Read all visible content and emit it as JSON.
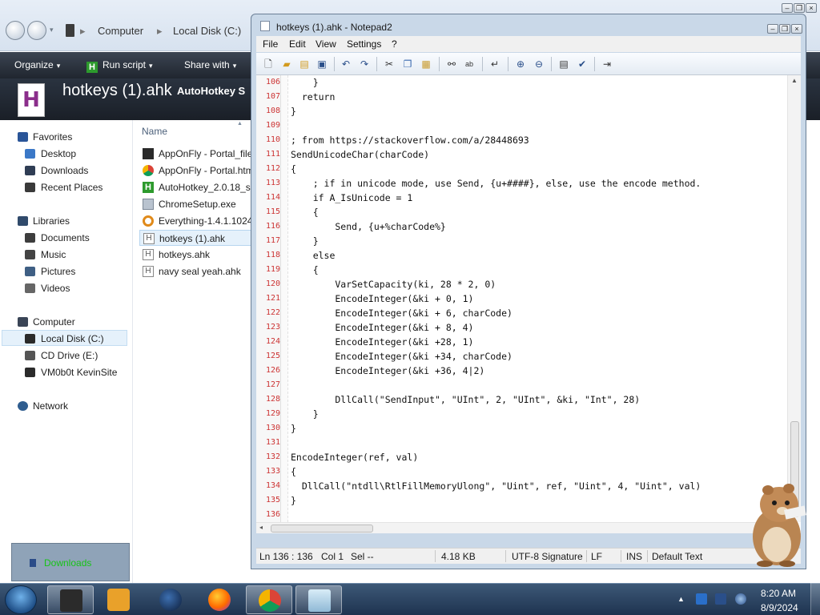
{
  "explorer": {
    "breadcrumb": {
      "sep": "▸",
      "computer": "Computer",
      "disk": "Local Disk (C:)"
    },
    "toolbar": {
      "organize": "Organize",
      "run_script": "Run script",
      "share_with": "Share with",
      "arrow": "▾"
    },
    "details": {
      "filename": "hotkeys (1).ahk",
      "type": "AutoHotkey S",
      "icon_letter": "H"
    },
    "nav": {
      "favorites": "Favorites",
      "desktop": "Desktop",
      "downloads": "Downloads",
      "recent": "Recent Places",
      "libraries": "Libraries",
      "documents": "Documents",
      "music": "Music",
      "pictures": "Pictures",
      "videos": "Videos",
      "computer": "Computer",
      "local_disk": "Local Disk (C:)",
      "cd_drive": "CD Drive (E:)",
      "vmshare": "VM0b0t KevinSite",
      "network": "Network"
    },
    "list": {
      "column_name": "Name",
      "files": [
        {
          "name": "AppOnFly - Portal_file",
          "icon": "app-icon"
        },
        {
          "name": "AppOnFly - Portal.htm",
          "icon": "chrome-icon"
        },
        {
          "name": "AutoHotkey_2.0.18_se",
          "icon": "autohotkey-icon"
        },
        {
          "name": "ChromeSetup.exe",
          "icon": "setup-icon"
        },
        {
          "name": "Everything-1.4.1.1024.",
          "icon": "everything-icon"
        },
        {
          "name": "hotkeys (1).ahk",
          "icon": "ahk-file-icon"
        },
        {
          "name": "hotkeys.ahk",
          "icon": "ahk-file-icon"
        },
        {
          "name": "navy seal yeah.ahk",
          "icon": "ahk-file-icon"
        }
      ]
    },
    "downloads_notification": "Downloads"
  },
  "notepad": {
    "title": "hotkeys (1).ahk - Notepad2",
    "menu": [
      "File",
      "Edit",
      "View",
      "Settings",
      "?"
    ],
    "lines": [
      {
        "n": "106",
        "text": "    }"
      },
      {
        "n": "107",
        "text": "  return"
      },
      {
        "n": "108",
        "text": "}"
      },
      {
        "n": "109",
        "text": ""
      },
      {
        "n": "110",
        "text": "; from https://stackoverflow.com/a/28448693"
      },
      {
        "n": "111",
        "text": "SendUnicodeChar(charCode)"
      },
      {
        "n": "112",
        "text": "{"
      },
      {
        "n": "113",
        "text": "    ; if in unicode mode, use Send, {u+####}, else, use the encode method."
      },
      {
        "n": "114",
        "text": "    if A_IsUnicode = 1"
      },
      {
        "n": "115",
        "text": "    {"
      },
      {
        "n": "116",
        "text": "        Send, {u+%charCode%}"
      },
      {
        "n": "117",
        "text": "    }"
      },
      {
        "n": "118",
        "text": "    else"
      },
      {
        "n": "119",
        "text": "    {"
      },
      {
        "n": "120",
        "text": "        VarSetCapacity(ki, 28 * 2, 0)"
      },
      {
        "n": "121",
        "text": "        EncodeInteger(&ki + 0, 1)"
      },
      {
        "n": "122",
        "text": "        EncodeInteger(&ki + 6, charCode)"
      },
      {
        "n": "123",
        "text": "        EncodeInteger(&ki + 8, 4)"
      },
      {
        "n": "124",
        "text": "        EncodeInteger(&ki +28, 1)"
      },
      {
        "n": "125",
        "text": "        EncodeInteger(&ki +34, charCode)"
      },
      {
        "n": "126",
        "text": "        EncodeInteger(&ki +36, 4|2)"
      },
      {
        "n": "127",
        "text": ""
      },
      {
        "n": "128",
        "text": "        DllCall(\"SendInput\", \"UInt\", 2, \"UInt\", &ki, \"Int\", 28)"
      },
      {
        "n": "129",
        "text": "    }"
      },
      {
        "n": "130",
        "text": "}"
      },
      {
        "n": "131",
        "text": ""
      },
      {
        "n": "132",
        "text": "EncodeInteger(ref, val)"
      },
      {
        "n": "133",
        "text": "{"
      },
      {
        "n": "134",
        "text": "  DllCall(\"ntdll\\RtlFillMemoryUlong\", \"Uint\", ref, \"Uint\", 4, \"Uint\", val)"
      },
      {
        "n": "135",
        "text": "}"
      },
      {
        "n": "136",
        "text": ""
      }
    ],
    "status": {
      "position": "Ln 136 : 136",
      "col": "Col 1",
      "sel": "Sel --",
      "size": "4.18 KB",
      "encoding": "UTF-8 Signature",
      "eol": "LF",
      "mode": "INS",
      "scheme": "Default Text"
    }
  },
  "taskbar": {
    "time": "8:20 AM",
    "date": "8/9/2024"
  },
  "colors": {
    "line_number": "#cc3333",
    "toolbar_dark": "#20262f",
    "taskbar": "#1e3350"
  }
}
